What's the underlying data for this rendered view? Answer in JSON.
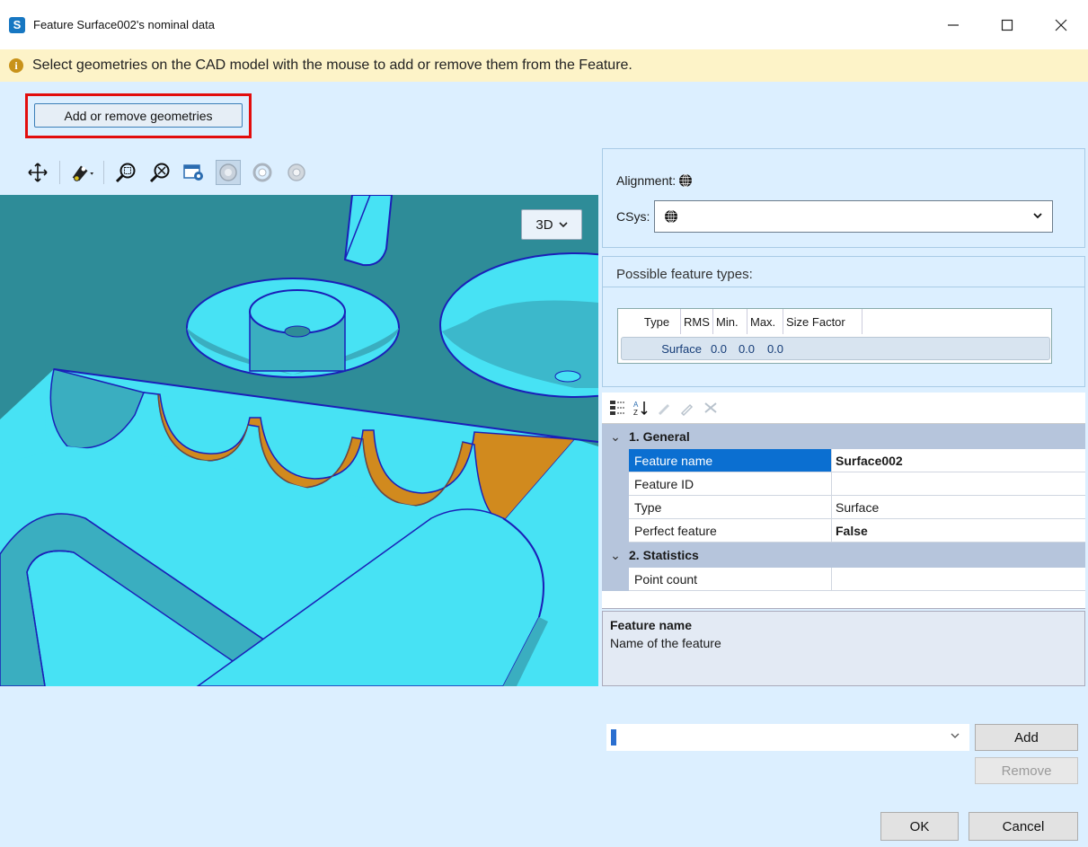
{
  "window": {
    "title": "Feature Surface002's nominal data",
    "app_icon_letter": "S"
  },
  "info": {
    "message": "Select geometries on the CAD model with the mouse to add or remove them from the Feature."
  },
  "actions": {
    "add_remove_label": "Add or remove geometries"
  },
  "viewport": {
    "view_mode": "3D",
    "colors": {
      "background": "#47e2f4",
      "model_top": "#2e8c98",
      "model_wall": "#3aaec0",
      "selected_surface": "#d18a1e",
      "edge": "#1a1fb8"
    }
  },
  "alignment": {
    "label": "Alignment:",
    "csys_label": "CSys:"
  },
  "feature_types": {
    "title": "Possible feature types:",
    "columns": [
      "Type",
      "RMS",
      "Min.",
      "Max.",
      "Size Factor"
    ],
    "rows": [
      {
        "type": "Surface",
        "rms": "0.0",
        "min": "0.0",
        "max": "0.0",
        "size_factor": ""
      }
    ]
  },
  "properties": {
    "categories": [
      {
        "label": "1. General",
        "rows": [
          {
            "name": "Feature name",
            "value": "Surface002"
          },
          {
            "name": "Feature ID",
            "value": ""
          },
          {
            "name": "Type",
            "value": "Surface"
          },
          {
            "name": "Perfect feature",
            "value": "False"
          }
        ]
      },
      {
        "label": "2. Statistics",
        "rows": [
          {
            "name": "Point count",
            "value": ""
          }
        ]
      }
    ]
  },
  "description": {
    "title": "Feature name",
    "text": "Name of the feature"
  },
  "bottom": {
    "combo_value": "",
    "add_label": "Add",
    "remove_label": "Remove",
    "ok_label": "OK",
    "cancel_label": "Cancel"
  }
}
